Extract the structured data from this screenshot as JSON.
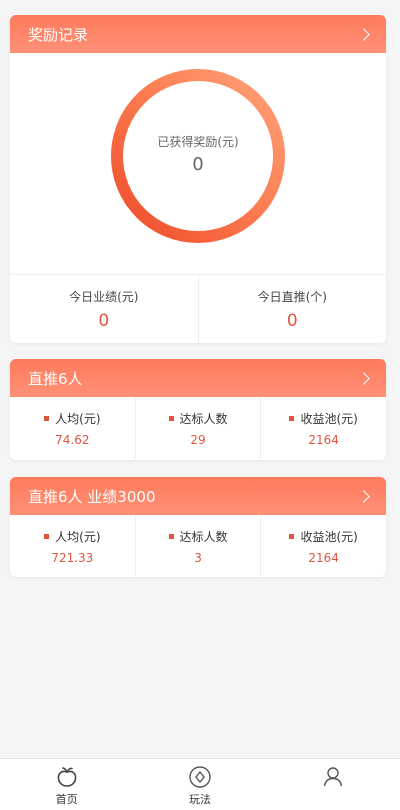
{
  "rewards": {
    "title": "奖励记录",
    "ring_label": "已获得奖励(元)",
    "ring_value": "0",
    "stats": [
      {
        "label": "今日业绩(元)",
        "value": "0"
      },
      {
        "label": "今日直推(个)",
        "value": "0"
      }
    ]
  },
  "push6": {
    "title": "直推6人",
    "items": [
      {
        "label": "人均(元)",
        "value": "74.62"
      },
      {
        "label": "达标人数",
        "value": "29"
      },
      {
        "label": "收益池(元)",
        "value": "2164"
      }
    ]
  },
  "push6_3000": {
    "title": "直推6人 业绩3000",
    "items": [
      {
        "label": "人均(元)",
        "value": "721.33"
      },
      {
        "label": "达标人数",
        "value": "3"
      },
      {
        "label": "收益池(元)",
        "value": "2164"
      }
    ]
  },
  "tabbar": {
    "items": [
      {
        "label": "首页",
        "icon": "home-fruit-icon"
      },
      {
        "label": "玩法",
        "icon": "compass-icon"
      },
      {
        "label": "",
        "icon": "user-icon"
      }
    ]
  },
  "colors": {
    "accent": "#e0553f",
    "header_gradient_start": "#ff7a5c",
    "header_gradient_end": "#fd9177"
  }
}
